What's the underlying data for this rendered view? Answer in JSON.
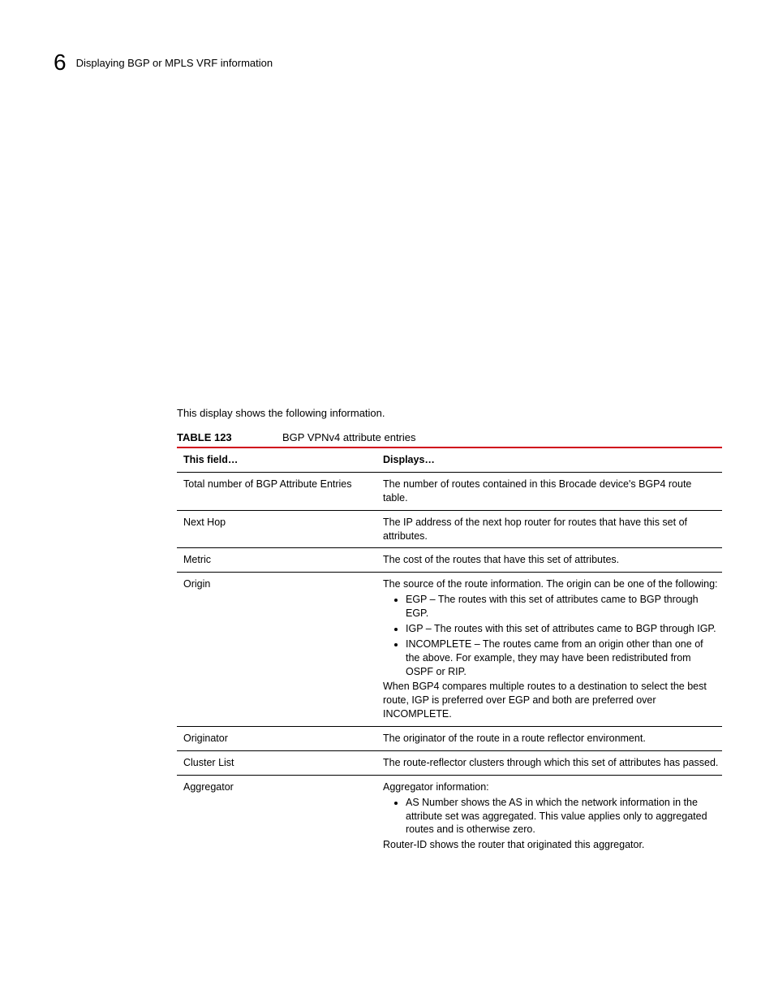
{
  "header": {
    "chapter_number": "6",
    "title": "Displaying BGP or MPLS VRF information"
  },
  "intro": "This display shows the following information.",
  "table": {
    "number": "TABLE 123",
    "title": "BGP VPNv4 attribute entries",
    "head_field": "This field…",
    "head_displays": "Displays…",
    "rows": {
      "r0": {
        "field": "Total number of BGP Attribute Entries",
        "disp": "The number of routes contained in this Brocade device's BGP4 route table."
      },
      "r1": {
        "field": "Next Hop",
        "disp": "The IP address of the next hop router for routes that have this set of attributes."
      },
      "r2": {
        "field": "Metric",
        "disp": "The cost of the routes that have this set of attributes."
      },
      "r3": {
        "field": "Origin",
        "pre": "The source of the route information. The origin can be one of the following:",
        "b0": "EGP – The routes with this set of attributes came to BGP through EGP.",
        "b1": "IGP – The routes with this set of attributes came to BGP through IGP.",
        "b2": "INCOMPLETE – The routes came from an origin other than one of the above. For example, they may have been redistributed from OSPF or RIP.",
        "post": "When BGP4 compares multiple routes to a destination to select the best route, IGP is preferred over EGP and both are preferred over INCOMPLETE."
      },
      "r4": {
        "field": "Originator",
        "disp": "The originator of the route in a route reflector environment."
      },
      "r5": {
        "field": "Cluster List",
        "disp": "The route-reflector clusters through which this set of attributes has passed."
      },
      "r6": {
        "field": "Aggregator",
        "pre": "Aggregator information:",
        "b0": "AS Number shows the AS in which the network information in the attribute set was aggregated. This value applies only to aggregated routes and is otherwise zero.",
        "post": "Router-ID shows the router that originated this aggregator."
      }
    }
  }
}
